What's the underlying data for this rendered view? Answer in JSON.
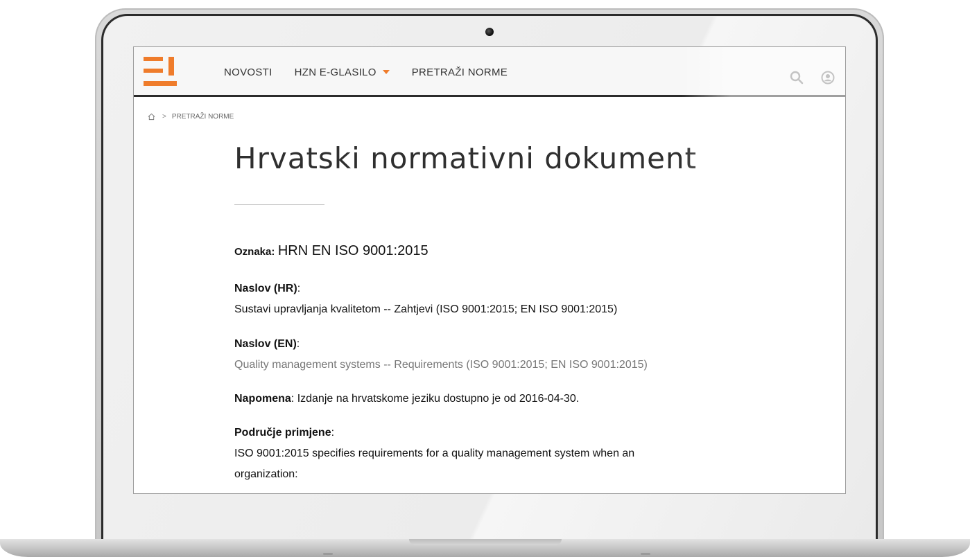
{
  "nav": {
    "items": [
      {
        "label": "NOVOSTI"
      },
      {
        "label": "HZN E-GLASILO",
        "has_dropdown": true
      },
      {
        "label": "PRETRAŽI NORME"
      }
    ]
  },
  "breadcrumb": {
    "home_icon": "home-icon",
    "current": "PRETRAŽI NORME"
  },
  "page": {
    "title": "Hrvatski normativni dokument"
  },
  "document": {
    "oznaka": {
      "label": "Oznaka:",
      "value": "HRN EN ISO 9001:2015"
    },
    "naslov_hr": {
      "label": "Naslov (HR)",
      "value": "Sustavi upravljanja kvalitetom -- Zahtjevi (ISO 9001:2015; EN ISO 9001:2015)"
    },
    "naslov_en": {
      "label": "Naslov (EN)",
      "value": "Quality management systems -- Requirements (ISO 9001:2015; EN ISO 9001:2015)"
    },
    "napomena": {
      "label": "Napomena",
      "value": ": Izdanje na hrvatskome jeziku dostupno je od 2016-04-30."
    },
    "podrucje": {
      "label": "Područje primjene",
      "lines": [
        "ISO 9001:2015 specifies requirements for a quality management system when an",
        "organization:"
      ]
    }
  },
  "header_icons": {
    "search": "search-icon",
    "user": "user-icon"
  },
  "colors": {
    "accent": "#ef7c2b",
    "header_border": "#2b2b2b",
    "text": "#111111"
  }
}
